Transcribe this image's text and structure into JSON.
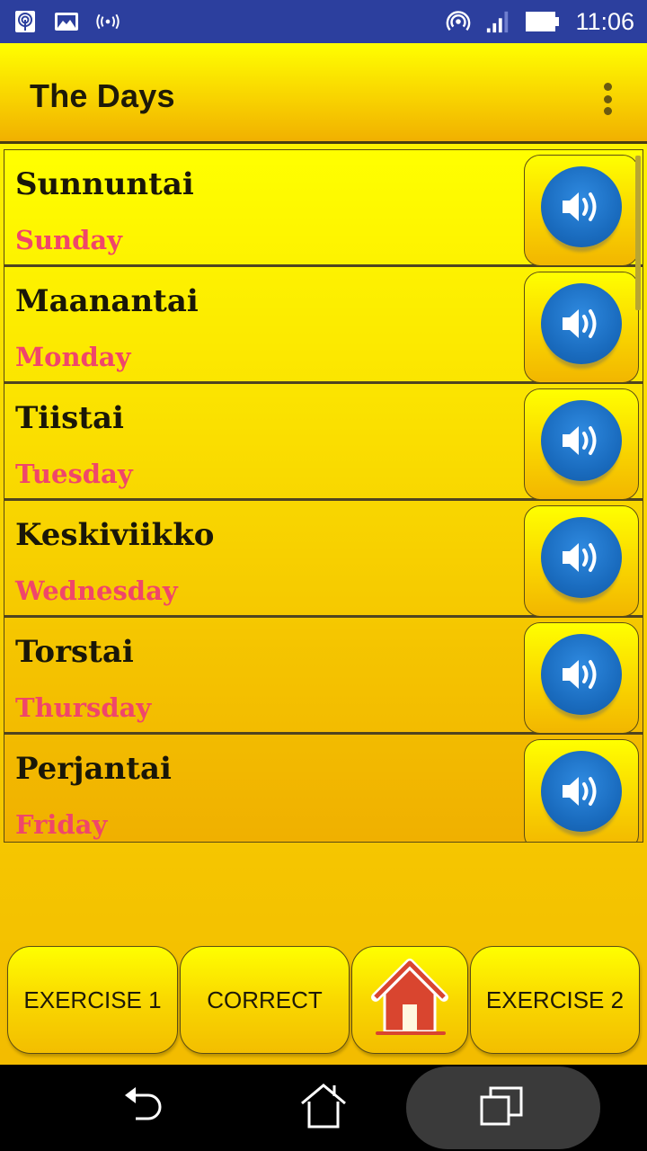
{
  "status_bar": {
    "left_icons": [
      "hotspot-icon",
      "gallery-icon",
      "radio-broadcast-icon"
    ],
    "right_icons": [
      "wifi-tethering-icon",
      "signal-icon",
      "battery-icon"
    ],
    "time": "11:06"
  },
  "app_bar": {
    "title": "The Days",
    "overflow_icon": "more-vertical-icon"
  },
  "colors": {
    "status_bar": "#2c3f9e",
    "accent_yellow": "#ffff00",
    "accent_orange": "#f2b600",
    "meaning_text": "#f0466a",
    "speaker_blue": "#1a6cbf",
    "home_red": "#d9452f"
  },
  "list": {
    "items": [
      {
        "word": "Sunnuntai",
        "meaning": "Sunday",
        "icon": "speaker-icon"
      },
      {
        "word": "Maanantai",
        "meaning": "Monday",
        "icon": "speaker-icon"
      },
      {
        "word": "Tiistai",
        "meaning": "Tuesday",
        "icon": "speaker-icon"
      },
      {
        "word": "Keskiviikko",
        "meaning": "Wednesday",
        "icon": "speaker-icon"
      },
      {
        "word": "Torstai",
        "meaning": "Thursday",
        "icon": "speaker-icon"
      },
      {
        "word": "Perjantai",
        "meaning": "Friday",
        "icon": "speaker-icon"
      }
    ]
  },
  "bottom_bar": {
    "exercise1": "EXERCISE 1",
    "correct": "CORRECT",
    "home_icon": "home-icon",
    "exercise2": "EXERCISE 2"
  },
  "nav_bar": {
    "back": "back-icon",
    "home": "home-outline-icon",
    "recents": "recents-icon"
  }
}
